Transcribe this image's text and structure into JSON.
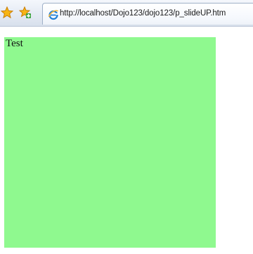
{
  "toolbar": {
    "favorites_icon": "star-icon",
    "add_favorites_icon": "add-to-favorites-icon"
  },
  "tab": {
    "favicon": "ie-page-icon",
    "title": "http://localhost/Dojo123/dojo123/p_slideUP.htm"
  },
  "page": {
    "panel_text": "Test",
    "panel_color": "#8ff98f"
  }
}
